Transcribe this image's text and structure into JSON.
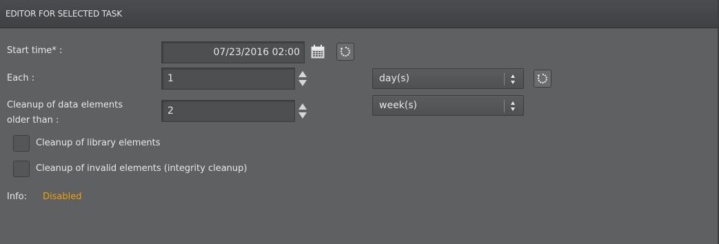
{
  "panel": {
    "title": "EDITOR FOR SELECTED TASK"
  },
  "form": {
    "start_time": {
      "label": "Start time* :",
      "value": "07/23/2016 02:00"
    },
    "each": {
      "label": "Each :",
      "value": "1",
      "unit": "day(s)"
    },
    "cleanup_older": {
      "label_line1": "Cleanup of data elements",
      "label_line2": "older than :",
      "value": "2",
      "unit": "week(s)"
    },
    "cleanup_library": {
      "label": "Cleanup of library elements",
      "checked": false
    },
    "cleanup_invalid": {
      "label": "Cleanup of invalid elements (integrity cleanup)",
      "checked": false
    },
    "info": {
      "label": "Info:",
      "value": "Disabled"
    }
  },
  "colors": {
    "info_value": "#f0a000"
  },
  "icons": {
    "calendar": "calendar-icon",
    "reset": "reset-icon",
    "spinner": "spinner-arrows-icon",
    "dropdown": "dropdown-arrows-icon"
  }
}
